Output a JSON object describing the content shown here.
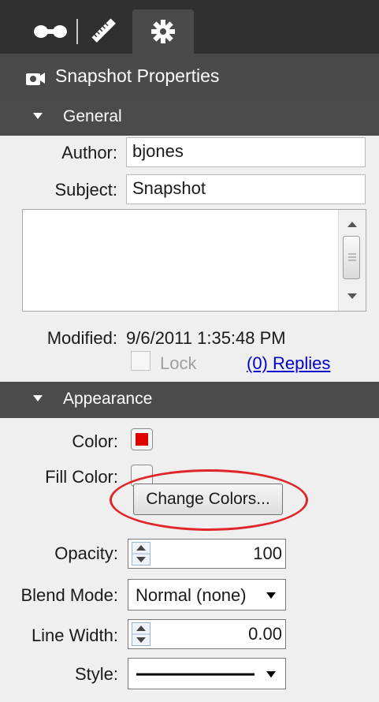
{
  "panel": {
    "title": "Snapshot Properties"
  },
  "tabs": [
    {
      "name": "markup",
      "icon": "binoculars-icon"
    },
    {
      "name": "measure",
      "icon": "ruler-icon"
    },
    {
      "name": "properties",
      "icon": "gear-icon",
      "active": true
    }
  ],
  "general": {
    "header": "General",
    "author_label": "Author:",
    "author_value": "bjones",
    "subject_label": "Subject:",
    "subject_value": "Snapshot",
    "comment_value": "",
    "modified_label": "Modified:",
    "modified_value": "9/6/2011 1:35:48 PM",
    "lock_label": "Lock",
    "replies_link": "(0) Replies"
  },
  "appearance": {
    "header": "Appearance",
    "color_label": "Color:",
    "color_value": "#e00000",
    "fill_label": "Fill Color:",
    "fill_value": "none",
    "change_colors": "Change Colors...",
    "opacity_label": "Opacity:",
    "opacity_value": "100",
    "blend_label": "Blend Mode:",
    "blend_value": "Normal (none)",
    "linewidth_label": "Line Width:",
    "linewidth_value": "0.00",
    "style_label": "Style:",
    "style_value": "solid-line"
  },
  "colors": {
    "dark_bg": "#303030",
    "header_bg": "#4a4a4a",
    "highlight": "#e0262a",
    "link": "#0000cc"
  }
}
